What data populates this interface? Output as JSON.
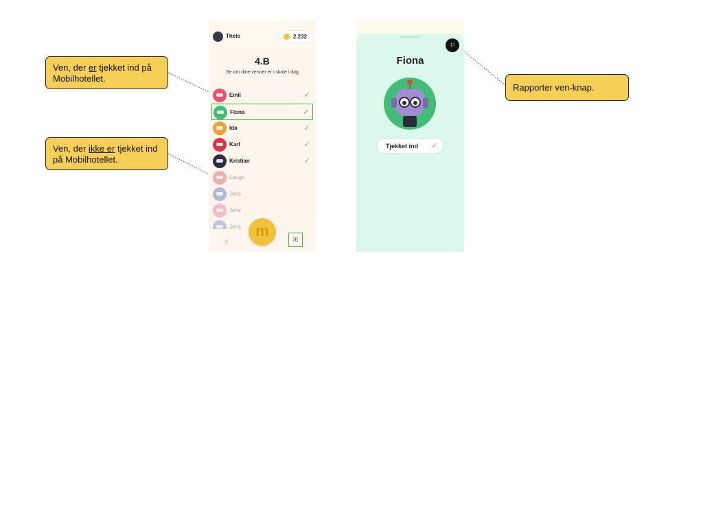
{
  "annotations": {
    "checked_in": {
      "pre": "Ven, der ",
      "em": "er",
      "post": " tjekket ind på Mobilhotellet."
    },
    "not_checked_in": {
      "pre": "Ven, der ",
      "em": "ikke er",
      "post": " tjekket ind på Mobilhotellet."
    },
    "report": {
      "text": "Rapporter ven-knap."
    }
  },
  "class_screen": {
    "user_name": "Theis",
    "coins": "2.232",
    "class_title": "4.B",
    "subtitle": "Se om dine venner er i skole i dag",
    "check_icon": "✓",
    "friends": [
      {
        "name": "Emil",
        "checked_in": true,
        "color": "#e5536d"
      },
      {
        "name": "Fiona",
        "checked_in": true,
        "color": "#41bc79"
      },
      {
        "name": "Ida",
        "checked_in": true,
        "color": "#f0a13a"
      },
      {
        "name": "Karl",
        "checked_in": true,
        "color": "#d9344a"
      },
      {
        "name": "Kristian",
        "checked_in": true,
        "color": "#2f2b45"
      },
      {
        "name": "Lauge",
        "checked_in": false,
        "color": "#e35b5b"
      },
      {
        "name": "Jens",
        "checked_in": false,
        "color": "#5b6fb3"
      },
      {
        "name": "Jens",
        "checked_in": false,
        "color": "#e87799"
      },
      {
        "name": "Jens",
        "checked_in": false,
        "color": "#6f8cd6"
      }
    ],
    "nav": {
      "home_icon": "⌂",
      "m_label": "m",
      "friends_icon": "ꕤ"
    }
  },
  "friend_screen": {
    "name": "Fiona",
    "status_label": "Tjekket ind",
    "check_icon": "✓",
    "report_icon": "⚐"
  },
  "colors": {
    "accent_yellow": "#f7cf57",
    "check_green": "#6fcf6f",
    "selection_green": "#3ec23e",
    "sheet_mint": "#dcf8ec"
  }
}
